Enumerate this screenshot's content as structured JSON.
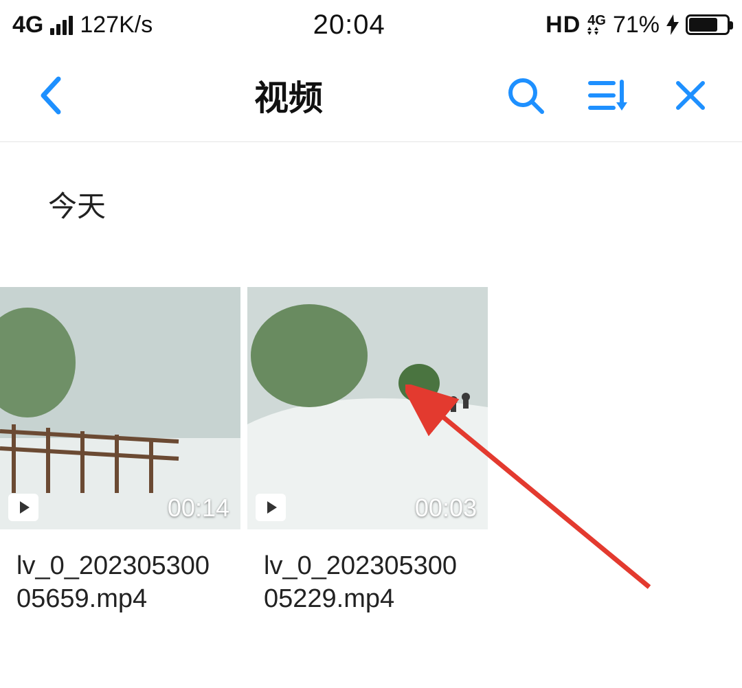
{
  "status_bar": {
    "network_type": "4G",
    "data_speed": "127K/s",
    "time": "20:04",
    "hd_label": "HD",
    "net_icon_label": "4G",
    "battery_percent": "71%"
  },
  "app_bar": {
    "title": "视频"
  },
  "section": {
    "today_label": "今天"
  },
  "videos": [
    {
      "duration": "00:14",
      "filename": "lv_0_20230530005659.mp4"
    },
    {
      "duration": "00:03",
      "filename": "lv_0_20230530005229.mp4"
    }
  ],
  "colors": {
    "accent": "#1e90ff",
    "arrow": "#e33a2f"
  }
}
